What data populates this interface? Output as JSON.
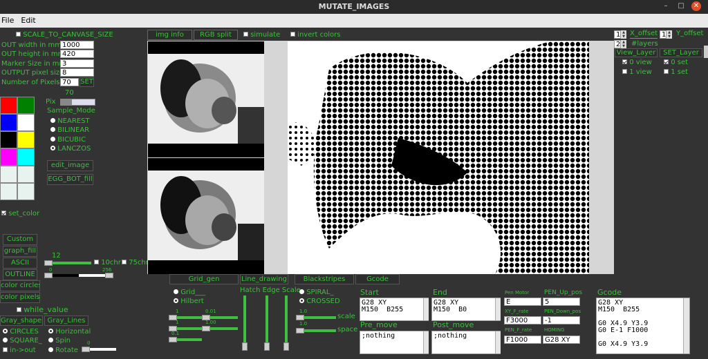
{
  "window": {
    "title": "MUTATE_IMAGES"
  },
  "menu": {
    "file": "File",
    "edit": "Edit"
  },
  "left": {
    "scale_to_canvas": "SCALE_TO_CANVASE_SIZE",
    "fields": [
      {
        "label": "OUT width in mm",
        "value": "1000"
      },
      {
        "label": "OUT height in mm",
        "value": "420"
      },
      {
        "label": "Marker Size in mm",
        "value": "3"
      },
      {
        "label": "OUTPUT pixel size",
        "value": "8"
      }
    ],
    "num_pixels_label": "Number of Pixels",
    "num_pixels_value": "70",
    "set_label": "SET",
    "pix_value": "70",
    "pix_label": "Pix",
    "sample_mode_label": "Sample_Mode",
    "sample_modes": [
      "NEAREST",
      "BILINEAR",
      "BICUBIC",
      "LANCZOS"
    ],
    "edit_image": "edit_image",
    "egg_bot_fill": "EGG_BOT_fill",
    "set_color": "set_color",
    "palette": [
      "#ff0000",
      "#008000",
      "#0000ff",
      "#ffffff",
      "#000000",
      "#ffff00",
      "#ff00ff",
      "#00ffff",
      "#e8f2ee",
      "#e8f2ee",
      "#e8f2ee",
      "#e8f2ee"
    ],
    "custom": "Custom",
    "graph_fill": "graph_fill",
    "ascii": "ASCII",
    "outline": "OUTLINE",
    "color_circles": "color circles",
    "color_pixels": "color pixels",
    "ascii_value": "12",
    "chr10": "10chr",
    "chr75": "75chr",
    "range_low": "0",
    "range_high": "256",
    "white_value": "while_value",
    "gray_shapes": "Gray_shapes",
    "gray_lines": "Gray_Lines",
    "shapes": [
      "CIRCLES",
      "SQUARE_",
      "in->out"
    ],
    "lines": [
      "Horizontal",
      "Spin",
      "Rotate"
    ],
    "rotate_value": "0"
  },
  "tabs": {
    "img_info": "img info",
    "rgb_split": "RGB split",
    "simulate": "simulate",
    "invert_colors": "invert colors"
  },
  "right": {
    "x_offset": "X_offset",
    "y_offset": "Y_offset",
    "x_val": "1",
    "y_val": "1",
    "layers_val": "2",
    "layers": "#layers",
    "view_layer": "View_Layer",
    "set_layer": "SET_Layer",
    "view_items": [
      "0 view",
      "1 view"
    ],
    "set_items": [
      "0 set",
      "1 set"
    ]
  },
  "bottom": {
    "tabs": [
      "Grid_gen",
      "Line_drawing",
      "Blackstripes",
      "Gcode"
    ],
    "grid": "Grid___",
    "hilbert": "Hilbert",
    "hatch": "Hatch Edge Scale",
    "spiral": "SPIRAL_",
    "crossed": "CROSSED",
    "scale": "scale",
    "space": "space",
    "slider_vals": [
      "1",
      "0.01",
      "1",
      "1.00",
      "0.1",
      "1.0",
      "1.0"
    ],
    "start_label": "Start",
    "start_text": "G28 XY\nM150  B255",
    "end_label": "End",
    "end_text": "G28 XY\nM150  B0",
    "pre_move_label": "Pre_move",
    "pre_move_text": ";nothing",
    "post_move_label": "Post_move",
    "post_move_text": ";nothing",
    "pen_motor_label": "Pen Motor",
    "pen_motor": "E",
    "pen_up_label": "PEN_Up_pos",
    "pen_up": "5",
    "xy_rate_label": "XY_F_rate",
    "xy_rate": "F3000",
    "pen_down_label": "PEN_Down_pos",
    "pen_down": "-1",
    "pen_rate_label": "PEN_F_rate",
    "pen_rate": "F1000",
    "homing_label": "HOMING",
    "homing": "G28 XY",
    "gcode_label": "Gcode",
    "gcode_text": "G28 XY\nM150  B255\n\nG0 X4.9 Y3.9\nG0 E-1 F1000\n\nG0 X4.9 Y3.9"
  }
}
